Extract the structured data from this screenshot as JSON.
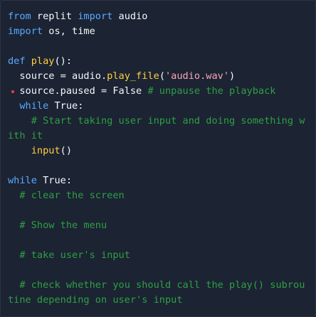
{
  "code": {
    "lines": [
      {
        "tokens": [
          {
            "t": "kw",
            "v": "from"
          },
          {
            "t": "pl",
            "v": " replit "
          },
          {
            "t": "kw",
            "v": "import"
          },
          {
            "t": "pl",
            "v": " audio"
          }
        ]
      },
      {
        "tokens": [
          {
            "t": "kw",
            "v": "import"
          },
          {
            "t": "pl",
            "v": " os, time"
          }
        ]
      },
      {
        "tokens": []
      },
      {
        "tokens": [
          {
            "t": "kw",
            "v": "def"
          },
          {
            "t": "pl",
            "v": " "
          },
          {
            "t": "fn",
            "v": "play"
          },
          {
            "t": "pl",
            "v": "():"
          }
        ]
      },
      {
        "tokens": [
          {
            "t": "pl",
            "v": "  source = audio."
          },
          {
            "t": "fn",
            "v": "play_file"
          },
          {
            "t": "pl",
            "v": "("
          },
          {
            "t": "str",
            "v": "'audio.wav'"
          },
          {
            "t": "pl",
            "v": ")"
          }
        ]
      },
      {
        "marker": true,
        "tokens": [
          {
            "t": "pl",
            "v": "  source.paused = False "
          },
          {
            "t": "cm",
            "v": "# unpause the playback"
          }
        ]
      },
      {
        "tokens": [
          {
            "t": "pl",
            "v": "  "
          },
          {
            "t": "kw",
            "v": "while"
          },
          {
            "t": "pl",
            "v": " True:"
          }
        ]
      },
      {
        "tokens": [
          {
            "t": "pl",
            "v": "    "
          },
          {
            "t": "cm",
            "v": "# Start taking user input and doing something with it"
          }
        ]
      },
      {
        "tokens": [
          {
            "t": "pl",
            "v": "    "
          },
          {
            "t": "fn",
            "v": "input"
          },
          {
            "t": "pl",
            "v": "()"
          }
        ]
      },
      {
        "tokens": []
      },
      {
        "tokens": [
          {
            "t": "kw",
            "v": "while"
          },
          {
            "t": "pl",
            "v": " True:"
          }
        ]
      },
      {
        "tokens": [
          {
            "t": "pl",
            "v": "  "
          },
          {
            "t": "cm",
            "v": "# clear the screen"
          }
        ]
      },
      {
        "tokens": []
      },
      {
        "tokens": [
          {
            "t": "pl",
            "v": "  "
          },
          {
            "t": "cm",
            "v": "# Show the menu"
          }
        ]
      },
      {
        "tokens": []
      },
      {
        "tokens": [
          {
            "t": "pl",
            "v": "  "
          },
          {
            "t": "cm",
            "v": "# take user's input"
          }
        ]
      },
      {
        "tokens": []
      },
      {
        "tokens": [
          {
            "t": "pl",
            "v": "  "
          },
          {
            "t": "cm",
            "v": "# check whether you should call the play() subroutine depending on user's input"
          }
        ]
      }
    ]
  },
  "colors": {
    "background": "#1c2333",
    "keyword": "#57abff",
    "function": "#ffcf40",
    "string": "#f7a7b5",
    "comment": "#2ea043",
    "plain": "#f5f9fc",
    "error_marker": "#f23f42"
  }
}
